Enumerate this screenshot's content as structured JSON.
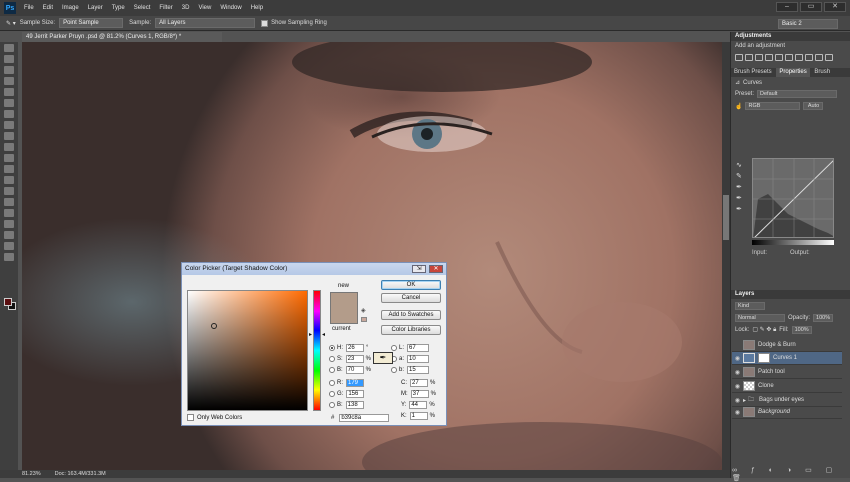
{
  "menubar": {
    "logo": "Ps",
    "items": [
      "File",
      "Edit",
      "Image",
      "Layer",
      "Type",
      "Select",
      "Filter",
      "3D",
      "View",
      "Window",
      "Help"
    ]
  },
  "options_bar": {
    "sample_size_label": "Sample Size:",
    "sample_size_value": "Point Sample",
    "sample_label": "Sample:",
    "sample_value": "All Layers",
    "show_ring_label": "Show Sampling Ring",
    "workspace_value": "Basic 2"
  },
  "document": {
    "tab_title": "49 Jerrit Parker Pruyn .psd @ 81.2% (Curves 1, RGB/8*) *",
    "zoom": "81.23%",
    "doc_size": "Doc: 163.4M/331.3M"
  },
  "panels": {
    "adjustments": {
      "title": "Adjustments",
      "subtitle": "Add an adjustment"
    },
    "properties_tabs": [
      "Brush Presets",
      "Properties",
      "Brush"
    ],
    "curves": {
      "label": "Curves",
      "preset_label": "Preset:",
      "preset_value": "Default",
      "channel_value": "RGB",
      "auto_label": "Auto",
      "input_label": "Input:",
      "output_label": "Output:"
    },
    "layers": {
      "title": "Layers",
      "filter_value": "Kind",
      "blend_mode": "Normal",
      "opacity_label": "Opacity:",
      "opacity_value": "100%",
      "lock_label": "Lock:",
      "fill_label": "Fill:",
      "fill_value": "100%",
      "items": [
        {
          "name": "Dodge & Burn",
          "selected": false
        },
        {
          "name": "Curves 1",
          "selected": true
        },
        {
          "name": "Patch tool",
          "selected": false
        },
        {
          "name": "Clone",
          "selected": false
        },
        {
          "name": "Bags under eyes",
          "selected": false
        },
        {
          "name": "Background",
          "selected": false
        }
      ]
    }
  },
  "color_picker": {
    "title": "Color Picker (Target Shadow Color)",
    "new_label": "new",
    "current_label": "current",
    "new_color": "#b39c8a",
    "current_color": "#b39c8a",
    "buttons": {
      "ok": "OK",
      "cancel": "Cancel",
      "add_swatches": "Add to Swatches",
      "color_libraries": "Color Libraries"
    },
    "only_web_colors": "Only Web Colors",
    "hsb": [
      {
        "label": "H:",
        "value": "26",
        "unit": "°",
        "selected": true
      },
      {
        "label": "S:",
        "value": "23",
        "unit": "%",
        "selected": false
      },
      {
        "label": "B:",
        "value": "70",
        "unit": "%",
        "selected": false
      }
    ],
    "rgb": [
      {
        "label": "R:",
        "value": "179",
        "selected": false,
        "highlighted": true
      },
      {
        "label": "G:",
        "value": "156",
        "selected": false,
        "highlighted": false
      },
      {
        "label": "B:",
        "value": "138",
        "selected": false,
        "highlighted": false
      }
    ],
    "lab": [
      {
        "label": "L:",
        "value": "67"
      },
      {
        "label": "a:",
        "value": "10"
      },
      {
        "label": "b:",
        "value": "15"
      }
    ],
    "cmyk": [
      {
        "label": "C:",
        "value": "27",
        "unit": "%"
      },
      {
        "label": "M:",
        "value": "37",
        "unit": "%"
      },
      {
        "label": "Y:",
        "value": "44",
        "unit": "%"
      },
      {
        "label": "K:",
        "value": "1",
        "unit": "%"
      }
    ],
    "hex_label": "#",
    "hex_value": "b39c8a"
  }
}
